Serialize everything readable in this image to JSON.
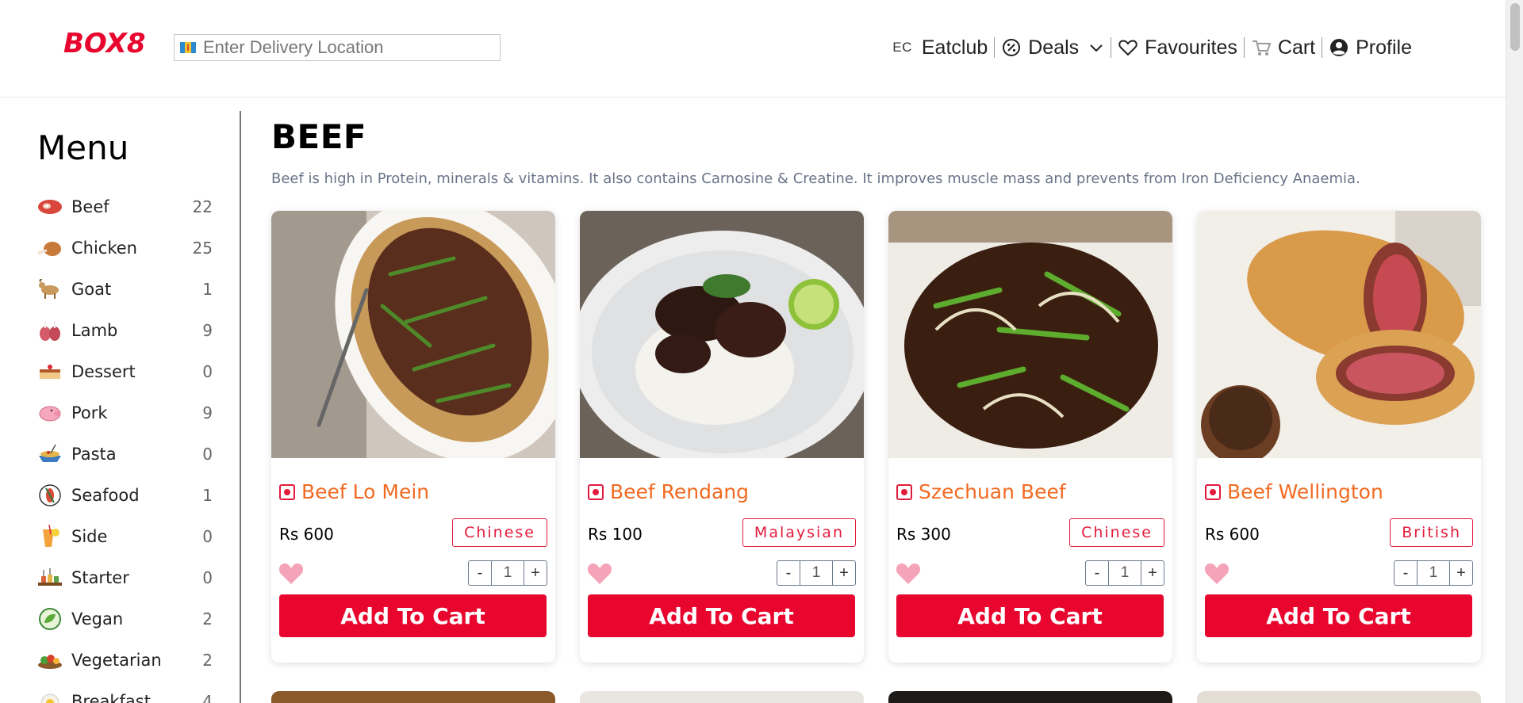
{
  "header": {
    "logo_text": "BOX8",
    "location_placeholder": "Enter Delivery Location",
    "nav": {
      "eatclub_mark": "EC",
      "eatclub_label": "Eatclub",
      "deals_label": "Deals",
      "favourites_label": "Favourites",
      "cart_label": "Cart",
      "profile_label": "Profile"
    }
  },
  "sidebar": {
    "title": "Menu",
    "items": [
      {
        "label": "Beef",
        "count": "22",
        "icon": "meat-icon"
      },
      {
        "label": "Chicken",
        "count": "25",
        "icon": "chicken-leg-icon"
      },
      {
        "label": "Goat",
        "count": "1",
        "icon": "goat-icon"
      },
      {
        "label": "Lamb",
        "count": "9",
        "icon": "lamb-icon"
      },
      {
        "label": "Dessert",
        "count": "0",
        "icon": "cake-icon"
      },
      {
        "label": "Pork",
        "count": "9",
        "icon": "pig-icon"
      },
      {
        "label": "Pasta",
        "count": "0",
        "icon": "pasta-icon"
      },
      {
        "label": "Seafood",
        "count": "1",
        "icon": "fish-icon"
      },
      {
        "label": "Side",
        "count": "0",
        "icon": "drink-icon"
      },
      {
        "label": "Starter",
        "count": "0",
        "icon": "starter-icon"
      },
      {
        "label": "Vegan",
        "count": "2",
        "icon": "leaf-icon"
      },
      {
        "label": "Vegetarian",
        "count": "2",
        "icon": "vegetables-icon"
      },
      {
        "label": "Breakfast",
        "count": "4",
        "icon": "breakfast-icon"
      }
    ]
  },
  "main": {
    "title": "BEEF",
    "description": "Beef is high in Protein, minerals & vitamins. It also contains Carnosine & Creatine. It improves muscle mass and prevents from Iron Deficiency Anaemia.",
    "cards": [
      {
        "name": "Beef Lo Mein",
        "price": "Rs 600",
        "cuisine": "Chinese",
        "qty": "1",
        "add_label": "Add To Cart",
        "minus": "-",
        "plus": "+"
      },
      {
        "name": "Beef Rendang",
        "price": "Rs 100",
        "cuisine": "Malaysian",
        "qty": "1",
        "add_label": "Add To Cart",
        "minus": "-",
        "plus": "+"
      },
      {
        "name": "Szechuan Beef",
        "price": "Rs 300",
        "cuisine": "Chinese",
        "qty": "1",
        "add_label": "Add To Cart",
        "minus": "-",
        "plus": "+"
      },
      {
        "name": "Beef Wellington",
        "price": "Rs 600",
        "cuisine": "British",
        "qty": "1",
        "add_label": "Add To Cart",
        "minus": "-",
        "plus": "+"
      }
    ]
  },
  "colors": {
    "accent_red": "#e8062f",
    "dish_name_orange": "#f26a21",
    "heart_pink": "#f5a3b8"
  }
}
